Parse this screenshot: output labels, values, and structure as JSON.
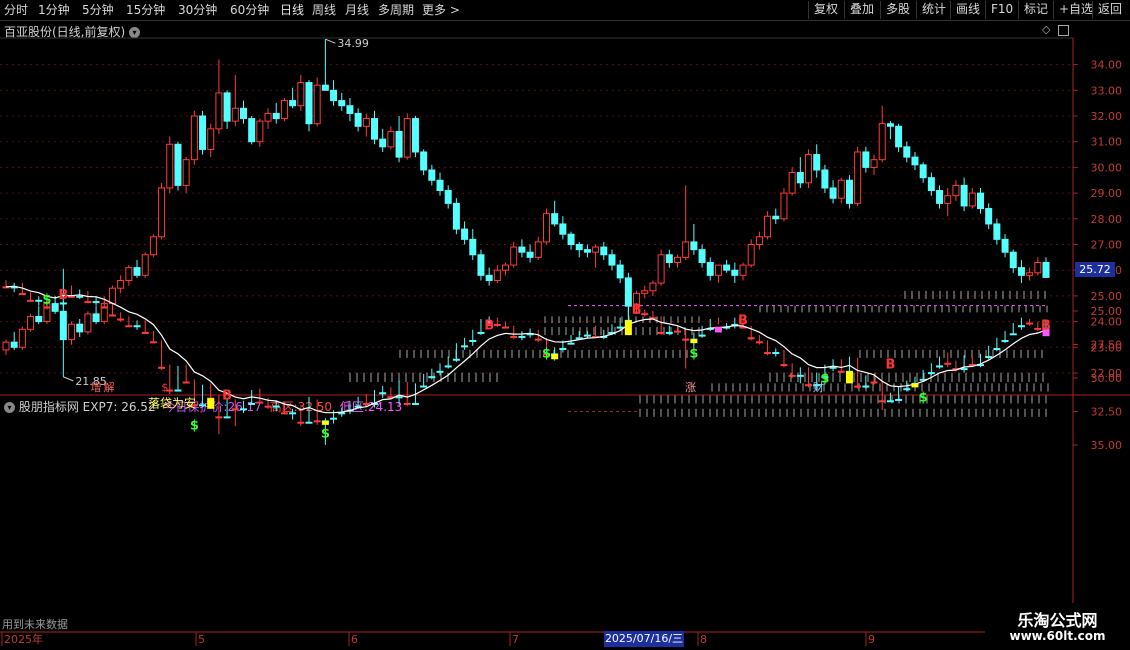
{
  "toolbar": {
    "left_items": [
      "分时",
      "1分钟",
      "5分钟",
      "15分钟",
      "30分钟",
      "60分钟",
      "日线",
      "周线",
      "月线",
      "多周期",
      "更多 >"
    ],
    "active": "日线",
    "right_items": [
      "复权",
      "叠加",
      "多股",
      "统计",
      "画线",
      "F10",
      "标记",
      "+自选",
      "返回"
    ]
  },
  "main_panel": {
    "title": "百亚股份(日线,前复权)",
    "price_axis": [
      "34.00",
      "33.00",
      "32.00",
      "31.00",
      "30.00",
      "29.00",
      "28.00",
      "27.00",
      "26.00",
      "25.00",
      "24.00",
      "23.00",
      "22.00"
    ],
    "high_label": "34.99",
    "low_label": "21.85",
    "current_price": "25.72",
    "events": [
      "增",
      "解",
      "$",
      "涨",
      "财"
    ]
  },
  "indicator_panel": {
    "name": "股朋指标网",
    "exp7_label": "EXP7:",
    "exp7_value": "26.52",
    "protect_label": "今日保护价:",
    "protect_value": "26.17",
    "high_zone_label": "高区:",
    "high_zone_value": "32.50",
    "low_zone_label": "低区:",
    "low_zone_value": "24.13",
    "axis": [
      "35.00",
      "32.50",
      "30.00",
      "27.50",
      "25.00"
    ],
    "annotation": "落袋为安",
    "buy_mark": "B",
    "sell_mark": "$"
  },
  "time_axis": {
    "labels": [
      "2025年",
      "5",
      "6",
      "7",
      "8",
      "9"
    ],
    "highlighted_date": "2025/07/16/三"
  },
  "footer_note": "用到未来数据",
  "watermark": {
    "line1": "乐淘公式网",
    "line2": "www.60lt.com"
  },
  "colors": {
    "up": "#ff3b3b",
    "down": "#54ffff",
    "axis": "#aa2222",
    "active_blue": "#1b2f9e",
    "magenta": "#ff55ff",
    "yellow": "#ffff00",
    "white_line": "#ffffff",
    "green_mark": "#33ff33",
    "red_mark": "#ff3333"
  },
  "chart_data": {
    "type": "candlestick",
    "ohlc": [
      [
        22.9,
        23.3,
        22.7,
        23.2
      ],
      [
        23.2,
        23.6,
        22.9,
        23.0
      ],
      [
        23.0,
        23.8,
        22.9,
        23.7
      ],
      [
        23.7,
        24.3,
        23.6,
        24.2
      ],
      [
        24.2,
        24.6,
        23.9,
        24.0
      ],
      [
        24.0,
        24.9,
        23.9,
        24.7
      ],
      [
        24.7,
        25.0,
        24.3,
        24.4
      ],
      [
        24.4,
        24.8,
        21.85,
        23.3
      ],
      [
        23.3,
        24.0,
        23.1,
        23.9
      ],
      [
        23.9,
        24.1,
        23.4,
        23.6
      ],
      [
        23.6,
        24.4,
        23.5,
        24.3
      ],
      [
        24.3,
        24.6,
        23.9,
        24.0
      ],
      [
        24.0,
        24.8,
        23.9,
        24.7
      ],
      [
        24.7,
        25.4,
        24.5,
        25.3
      ],
      [
        25.3,
        25.8,
        25.1,
        25.6
      ],
      [
        25.6,
        26.2,
        25.4,
        26.1
      ],
      [
        26.1,
        26.4,
        25.7,
        25.8
      ],
      [
        25.8,
        26.7,
        25.7,
        26.6
      ],
      [
        26.6,
        27.4,
        26.5,
        27.3
      ],
      [
        27.3,
        29.4,
        27.2,
        29.2
      ],
      [
        29.2,
        31.2,
        29.0,
        30.9
      ],
      [
        30.9,
        31.0,
        29.1,
        29.3
      ],
      [
        29.3,
        30.4,
        29.0,
        30.3
      ],
      [
        30.3,
        32.2,
        30.1,
        32.0
      ],
      [
        32.0,
        32.2,
        30.5,
        30.7
      ],
      [
        30.7,
        31.7,
        30.4,
        31.5
      ],
      [
        31.5,
        34.2,
        31.3,
        32.9
      ],
      [
        32.9,
        33.0,
        31.5,
        31.8
      ],
      [
        31.8,
        33.6,
        31.6,
        32.3
      ],
      [
        32.3,
        32.6,
        31.7,
        31.9
      ],
      [
        31.9,
        32.0,
        30.9,
        31.0
      ],
      [
        31.0,
        31.9,
        30.8,
        31.8
      ],
      [
        31.8,
        32.3,
        31.5,
        32.1
      ],
      [
        32.1,
        32.5,
        31.7,
        31.9
      ],
      [
        31.9,
        32.7,
        31.8,
        32.6
      ],
      [
        32.6,
        33.1,
        32.3,
        32.4
      ],
      [
        32.4,
        33.6,
        32.2,
        33.3
      ],
      [
        33.3,
        33.4,
        31.4,
        31.7
      ],
      [
        31.7,
        33.5,
        31.6,
        33.2
      ],
      [
        33.2,
        34.99,
        33.0,
        33.0
      ],
      [
        33.0,
        33.4,
        32.4,
        32.6
      ],
      [
        32.6,
        32.9,
        32.2,
        32.4
      ],
      [
        32.4,
        32.7,
        31.8,
        32.1
      ],
      [
        32.1,
        32.3,
        31.4,
        31.6
      ],
      [
        31.6,
        32.1,
        31.2,
        31.9
      ],
      [
        31.9,
        32.2,
        30.9,
        31.1
      ],
      [
        31.1,
        31.5,
        30.6,
        30.8
      ],
      [
        30.8,
        31.6,
        30.7,
        31.4
      ],
      [
        31.4,
        32.0,
        30.2,
        30.4
      ],
      [
        30.4,
        32.1,
        30.3,
        31.9
      ],
      [
        31.9,
        32.0,
        30.4,
        30.6
      ],
      [
        30.6,
        30.7,
        29.7,
        29.9
      ],
      [
        29.9,
        30.1,
        29.3,
        29.5
      ],
      [
        29.5,
        29.8,
        28.9,
        29.1
      ],
      [
        29.1,
        29.3,
        28.4,
        28.6
      ],
      [
        28.6,
        28.8,
        27.4,
        27.6
      ],
      [
        27.6,
        27.9,
        27.0,
        27.2
      ],
      [
        27.2,
        27.6,
        26.4,
        26.6
      ],
      [
        26.6,
        26.8,
        25.6,
        25.8
      ],
      [
        25.8,
        26.1,
        25.4,
        25.6
      ],
      [
        25.6,
        26.2,
        25.5,
        26.0
      ],
      [
        26.0,
        26.3,
        25.8,
        26.2
      ],
      [
        26.2,
        27.1,
        26.1,
        26.9
      ],
      [
        26.9,
        27.2,
        26.5,
        26.7
      ],
      [
        26.7,
        27.0,
        26.3,
        26.5
      ],
      [
        26.5,
        27.3,
        26.4,
        27.1
      ],
      [
        27.1,
        28.4,
        27.0,
        28.2
      ],
      [
        28.2,
        28.7,
        27.7,
        27.8
      ],
      [
        27.8,
        28.1,
        27.2,
        27.4
      ],
      [
        27.4,
        27.5,
        26.8,
        27.0
      ],
      [
        27.0,
        27.1,
        26.5,
        26.8
      ],
      [
        26.8,
        27.0,
        26.5,
        26.7
      ],
      [
        26.7,
        27.0,
        26.1,
        26.9
      ],
      [
        26.9,
        27.1,
        26.4,
        26.6
      ],
      [
        26.6,
        26.8,
        26.0,
        26.2
      ],
      [
        26.2,
        26.4,
        25.5,
        25.7
      ],
      [
        25.7,
        25.9,
        24.2,
        24.6
      ],
      [
        24.6,
        25.2,
        24.4,
        25.1
      ],
      [
        25.1,
        25.4,
        24.9,
        25.2
      ],
      [
        25.2,
        25.6,
        25.0,
        25.5
      ],
      [
        25.5,
        26.8,
        25.4,
        26.6
      ],
      [
        26.6,
        26.8,
        26.1,
        26.3
      ],
      [
        26.3,
        26.6,
        26.1,
        26.5
      ],
      [
        26.5,
        29.3,
        26.4,
        27.1
      ],
      [
        27.1,
        27.8,
        26.6,
        26.8
      ],
      [
        26.8,
        27.0,
        26.1,
        26.3
      ],
      [
        26.3,
        26.5,
        25.6,
        25.8
      ],
      [
        25.8,
        26.0,
        25.5,
        26.2
      ],
      [
        26.2,
        26.4,
        25.9,
        26.0
      ],
      [
        26.0,
        26.3,
        25.5,
        25.8
      ],
      [
        25.8,
        26.3,
        25.6,
        26.2
      ],
      [
        26.2,
        27.2,
        26.1,
        27.0
      ],
      [
        27.0,
        27.5,
        26.8,
        27.3
      ],
      [
        27.3,
        28.3,
        27.2,
        28.1
      ],
      [
        28.1,
        28.4,
        27.8,
        28.0
      ],
      [
        28.0,
        29.2,
        27.9,
        29.0
      ],
      [
        29.0,
        30.0,
        28.9,
        29.8
      ],
      [
        29.8,
        30.4,
        29.2,
        29.4
      ],
      [
        29.4,
        30.7,
        29.2,
        30.5
      ],
      [
        30.5,
        30.9,
        29.6,
        29.9
      ],
      [
        29.9,
        30.1,
        29.0,
        29.2
      ],
      [
        29.2,
        29.5,
        28.6,
        28.8
      ],
      [
        28.8,
        29.6,
        28.6,
        29.5
      ],
      [
        29.5,
        29.7,
        28.4,
        28.6
      ],
      [
        28.6,
        30.8,
        28.5,
        30.6
      ],
      [
        30.6,
        30.8,
        29.8,
        30.0
      ],
      [
        30.0,
        30.5,
        29.7,
        30.3
      ],
      [
        30.3,
        32.4,
        30.2,
        31.7
      ],
      [
        31.7,
        31.8,
        31.1,
        31.6
      ],
      [
        31.6,
        31.7,
        30.6,
        30.8
      ],
      [
        30.8,
        31.0,
        30.2,
        30.4
      ],
      [
        30.4,
        30.6,
        29.9,
        30.1
      ],
      [
        30.1,
        30.2,
        29.4,
        29.6
      ],
      [
        29.6,
        29.8,
        28.9,
        29.1
      ],
      [
        29.1,
        29.3,
        28.4,
        28.6
      ],
      [
        28.6,
        29.2,
        28.1,
        28.9
      ],
      [
        28.9,
        29.5,
        28.7,
        29.3
      ],
      [
        29.3,
        29.6,
        28.3,
        28.5
      ],
      [
        28.5,
        29.2,
        28.4,
        29.0
      ],
      [
        29.0,
        29.2,
        28.2,
        28.4
      ],
      [
        28.4,
        28.6,
        27.6,
        27.8
      ],
      [
        27.8,
        28.0,
        27.0,
        27.2
      ],
      [
        27.2,
        27.4,
        26.5,
        26.7
      ],
      [
        26.7,
        26.8,
        25.9,
        26.1
      ],
      [
        26.1,
        26.4,
        25.5,
        25.8
      ],
      [
        25.8,
        26.1,
        25.6,
        25.9
      ],
      [
        25.9,
        26.5,
        25.8,
        26.3
      ],
      [
        26.3,
        26.5,
        25.7,
        25.72
      ]
    ],
    "ylim": [
      21.5,
      35.3
    ]
  }
}
